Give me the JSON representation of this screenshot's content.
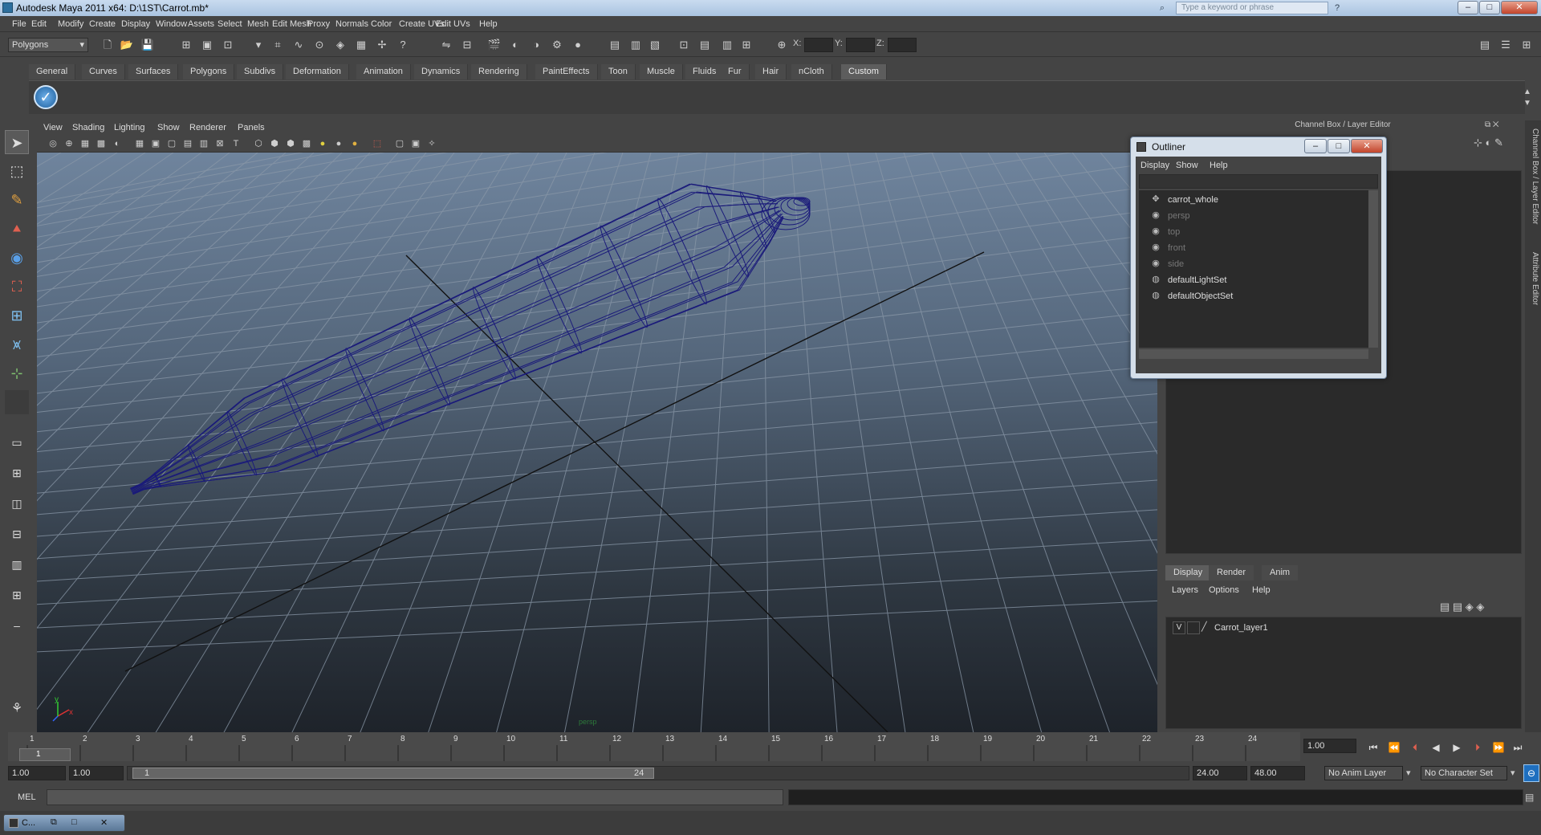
{
  "window": {
    "title": "Autodesk Maya 2011 x64: D:\\1ST\\Carrot.mb*",
    "search_placeholder": "Type a keyword or phrase",
    "minimize": "–",
    "maximize": "□",
    "close": "✕"
  },
  "menubar": [
    "File",
    "Edit",
    "Modify",
    "Create",
    "Display",
    "Window",
    "Assets",
    "Select",
    "Mesh",
    "Edit Mesh",
    "Proxy",
    "Normals",
    "Color",
    "Create UVs",
    "Edit UVs",
    "Help"
  ],
  "status": {
    "mode": "Polygons",
    "x_label": "X:",
    "y_label": "Y:",
    "z_label": "Z:"
  },
  "shelf_tabs": [
    "General",
    "Curves",
    "Surfaces",
    "Polygons",
    "Subdivs",
    "Deformation",
    "Animation",
    "Dynamics",
    "Rendering",
    "PaintEffects",
    "Toon",
    "Muscle",
    "Fluids",
    "Fur",
    "Hair",
    "nCloth",
    "Custom"
  ],
  "shelf_active": "Custom",
  "viewport": {
    "menu": [
      "View",
      "Shading",
      "Lighting",
      "Show",
      "Renderer",
      "Panels"
    ],
    "camera_label": "persp"
  },
  "channel_box": {
    "title": "Channel Box / Layer Editor",
    "side_tab_1": "Channel Box / Layer Editor",
    "side_tab_2": "Attribute Editor"
  },
  "layer_editor": {
    "tabs": [
      "Display",
      "Render",
      "Anim"
    ],
    "active_tab": "Display",
    "menu": [
      "Layers",
      "Options",
      "Help"
    ],
    "layers": [
      {
        "visible": "V",
        "name": "Carrot_layer1"
      }
    ]
  },
  "outliner": {
    "title": "Outliner",
    "menu": [
      "Display",
      "Show",
      "Help"
    ],
    "items": [
      {
        "name": "carrot_whole",
        "icon": "transform-icon",
        "dim": false
      },
      {
        "name": "persp",
        "icon": "camera-icon",
        "dim": true
      },
      {
        "name": "top",
        "icon": "camera-icon",
        "dim": true
      },
      {
        "name": "front",
        "icon": "camera-icon",
        "dim": true
      },
      {
        "name": "side",
        "icon": "camera-icon",
        "dim": true
      },
      {
        "name": "defaultLightSet",
        "icon": "set-icon",
        "dim": false
      },
      {
        "name": "defaultObjectSet",
        "icon": "set-icon",
        "dim": false
      }
    ]
  },
  "timeline": {
    "ticks": [
      "1",
      "2",
      "3",
      "4",
      "5",
      "6",
      "7",
      "8",
      "9",
      "10",
      "11",
      "12",
      "13",
      "14",
      "15",
      "16",
      "17",
      "18",
      "19",
      "20",
      "21",
      "22",
      "23",
      "24"
    ],
    "current_frame": "1",
    "current_time_field": "1.00"
  },
  "range": {
    "start": "1.00",
    "playback_start": "1.00",
    "slider_start": "1",
    "slider_end": "24",
    "playback_end": "24.00",
    "end": "48.00",
    "anim_layer": "No Anim Layer",
    "character_set": "No Character Set"
  },
  "command": {
    "label": "MEL"
  },
  "taskbar": {
    "item": "C..."
  }
}
